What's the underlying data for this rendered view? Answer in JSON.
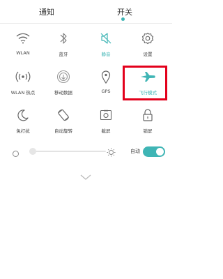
{
  "tabs": [
    {
      "label": "通知"
    },
    {
      "label": "开关"
    }
  ],
  "toggles": [
    {
      "label": "WLAN",
      "icon": "wifi-icon",
      "active": false
    },
    {
      "label": "蓝牙",
      "icon": "bluetooth-icon",
      "active": false
    },
    {
      "label": "静音",
      "icon": "mute-icon",
      "active": true
    },
    {
      "label": "设置",
      "icon": "gear-icon",
      "active": false
    },
    {
      "label": "WLAN 热点",
      "icon": "hotspot-icon",
      "active": false
    },
    {
      "label": "移动数据",
      "icon": "mobile-data-icon",
      "active": false
    },
    {
      "label": "GPS",
      "icon": "location-pin-icon",
      "active": false
    },
    {
      "label": "飞行模式",
      "icon": "airplane-icon",
      "active": true
    },
    {
      "label": "免打扰",
      "icon": "moon-icon",
      "active": false
    },
    {
      "label": "自动旋转",
      "icon": "rotate-icon",
      "active": false
    },
    {
      "label": "截屏",
      "icon": "screenshot-icon",
      "active": false
    },
    {
      "label": "锁屏",
      "icon": "lock-icon",
      "active": false
    }
  ],
  "brightness": {
    "auto_label": "自动",
    "auto_on": true,
    "level": 0.0
  },
  "colors": {
    "accent": "#3fb5b5",
    "highlight": "#e3001b"
  }
}
